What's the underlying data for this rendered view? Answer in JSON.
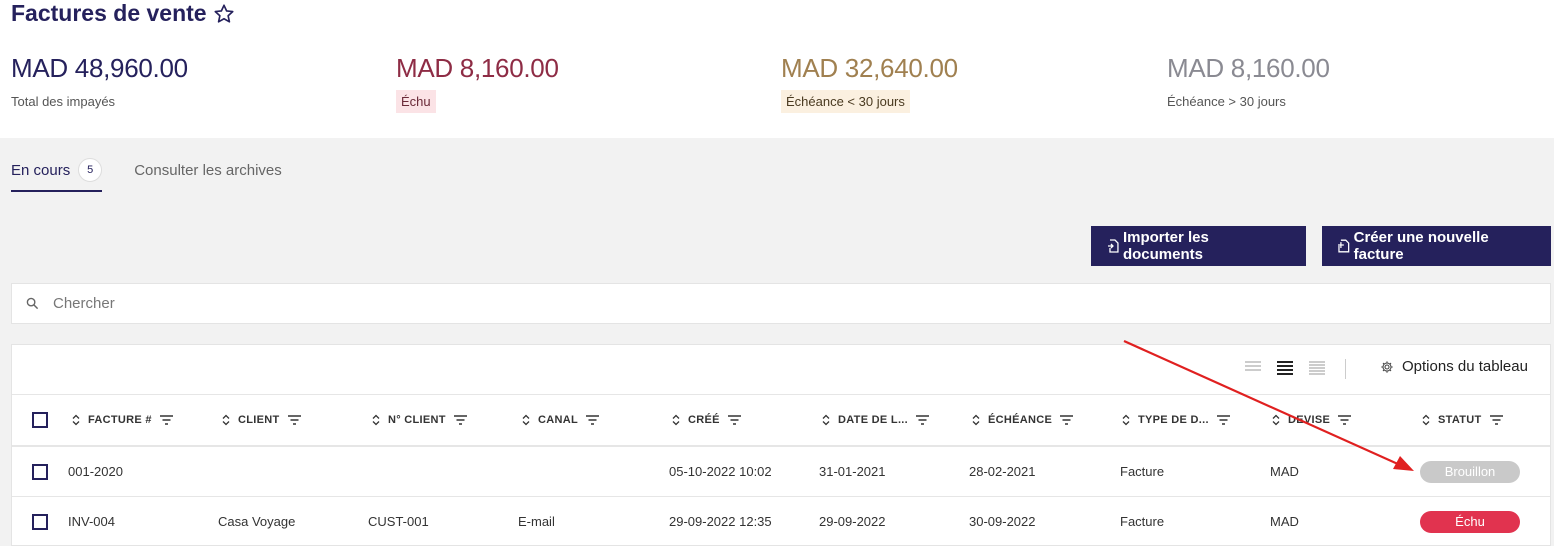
{
  "page": {
    "title": "Factures de vente"
  },
  "kpis": [
    {
      "amount": "MAD 48,960.00",
      "label": "Total des impayés",
      "amount_color": "#25215c",
      "label_bg": "transparent"
    },
    {
      "amount": "MAD 8,160.00",
      "label": "Échu",
      "amount_color": "#8e2c45",
      "label_bg": "#fbe3e6"
    },
    {
      "amount": "MAD 32,640.00",
      "label": "Échéance < 30 jours",
      "amount_color": "#a08050",
      "label_bg": "#fbf0e0"
    },
    {
      "amount": "MAD 8,160.00",
      "label": "Échéance > 30 jours",
      "amount_color": "#8a8a92",
      "label_bg": "transparent"
    }
  ],
  "tabs": {
    "active_label": "En cours",
    "active_count": "5",
    "archive_label": "Consulter les archives"
  },
  "buttons": {
    "import": "Importer les documents",
    "create": "Créer une nouvelle facture"
  },
  "search": {
    "placeholder": "Chercher"
  },
  "table": {
    "options_label": "Options du tableau",
    "columns": [
      "FACTURE #",
      "CLIENT",
      "N° CLIENT",
      "CANAL",
      "CRÉÉ",
      "DATE DE L...",
      "ÉCHÉANCE",
      "TYPE DE D...",
      "DEVISE",
      "STATUT"
    ],
    "rows": [
      {
        "facture": "001-2020",
        "client": "",
        "n_client": "",
        "canal": "",
        "cree": "05-10-2022 10:02",
        "date_l": "31-01-2021",
        "echeance": "28-02-2021",
        "type": "Facture",
        "devise": "MAD",
        "statut": "Brouillon",
        "statut_color": "#c9c9c9"
      },
      {
        "facture": "INV-004",
        "client": "Casa Voyage",
        "n_client": "CUST-001",
        "canal": "E-mail",
        "cree": "29-09-2022 12:35",
        "date_l": "29-09-2022",
        "echeance": "30-09-2022",
        "type": "Facture",
        "devise": "MAD",
        "statut": "Échu",
        "statut_color": "#e1334f"
      }
    ]
  },
  "colors": {
    "brand": "#25215c",
    "annotation_arrow": "#e02020"
  }
}
